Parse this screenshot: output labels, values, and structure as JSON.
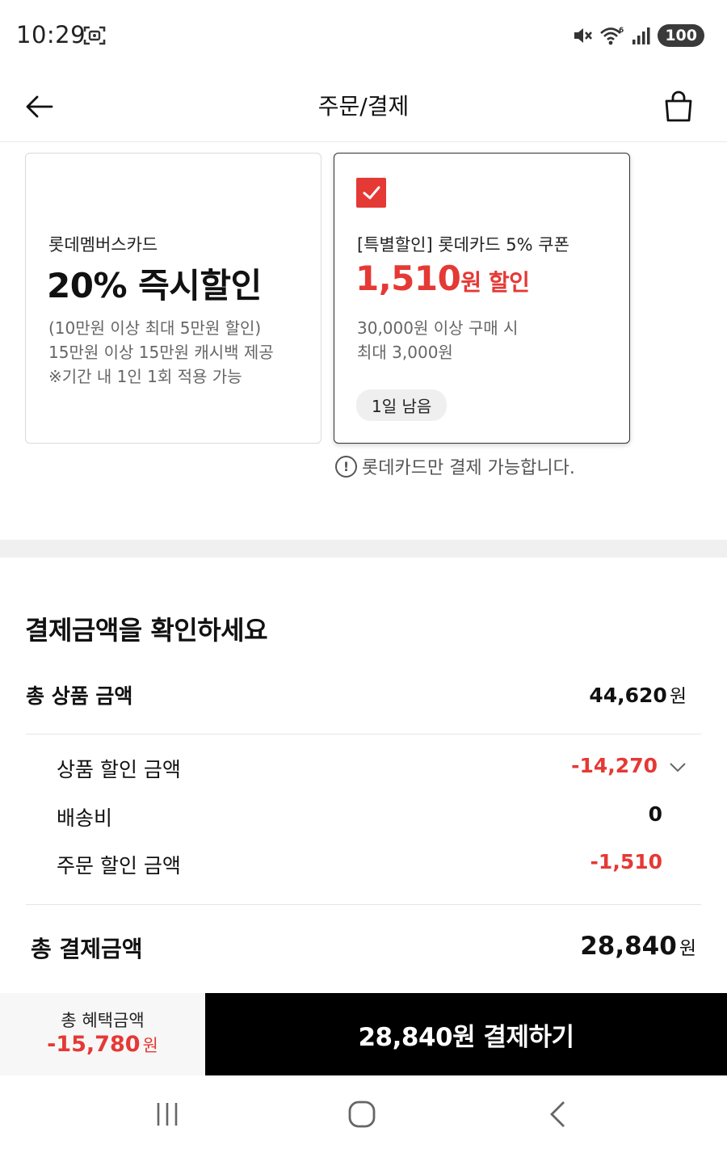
{
  "status_bar": {
    "time": "10:29",
    "battery": "100",
    "icons": [
      "screen-capture-icon",
      "mute-icon",
      "wifi-6-icon",
      "signal-icon"
    ]
  },
  "header": {
    "title": "주문/결제",
    "icons": [
      "back-arrow-icon",
      "shopping-bag-icon"
    ]
  },
  "coupons": [
    {
      "subtitle": "롯데멤버스카드",
      "headline": "20% 즉시할인",
      "desc": [
        "(10만원 이상 최대 5만원 할인)",
        "15만원 이상 15만원 캐시백 제공",
        "※기간 내 1인 1회 적용 가능"
      ],
      "selected": false
    },
    {
      "subtitle": "[특별할인] 롯데카드 5% 쿠폰",
      "headline_amount": "1,510",
      "headline_suffix": "원 할인",
      "desc": [
        "30,000원 이상 구매 시",
        "최대 3,000원"
      ],
      "badge": "1일 남음",
      "selected": true
    }
  ],
  "notice": "롯데카드만 결제 가능합니다.",
  "summary": {
    "title": "결제금액을 확인하세요",
    "total_product_label": "총 상품 금액",
    "total_product_value": "44,620",
    "won": "원",
    "product_discount_label": "상품 할인 금액",
    "product_discount_value": "-14,270",
    "shipping_label": "배송비",
    "shipping_value": "0",
    "order_discount_label": "주문 할인 금액",
    "order_discount_value": "-1,510",
    "total_payment_label": "총 결제금액",
    "total_payment_value": "28,840"
  },
  "bottom": {
    "benefit_label": "총 혜택금액",
    "benefit_value": "-15,780",
    "benefit_unit": "원",
    "pay_button": "28,840원 결제하기"
  },
  "colors": {
    "accent_red": "#e53935",
    "pay_button_bg": "#000000",
    "divider": "#f0f0f0"
  },
  "nav": [
    "recent-apps-icon",
    "home-icon",
    "back-icon"
  ]
}
